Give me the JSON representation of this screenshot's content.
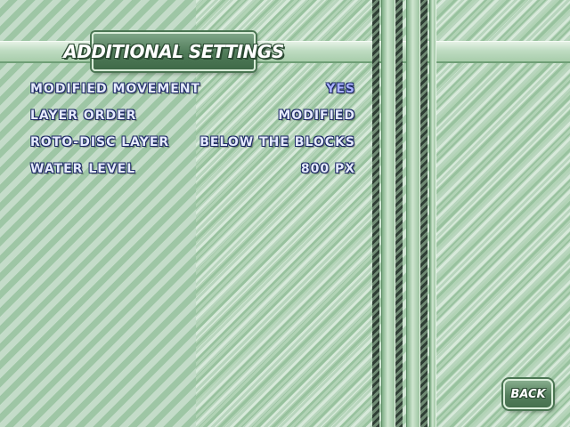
{
  "screen": {
    "title": "ADDITIONAL SETTINGS",
    "back_label": "BACK"
  },
  "settings": [
    {
      "label": "MODIFIED MOVEMENT",
      "value": "YES",
      "highlighted": true
    },
    {
      "label": "LAYER ORDER",
      "value": "MODIFIED",
      "highlighted": false
    },
    {
      "label": "ROTO-DISC LAYER",
      "value": "BELOW THE BLOCKS",
      "highlighted": false
    },
    {
      "label": "WATER LEVEL",
      "value": "800 PX",
      "highlighted": false
    }
  ],
  "colors": {
    "background": "#b4d6b8",
    "panel": "#4f7a58",
    "text": "#e6ebff",
    "text_outline": "#1e2a66",
    "highlight": "#a8b0ff"
  }
}
